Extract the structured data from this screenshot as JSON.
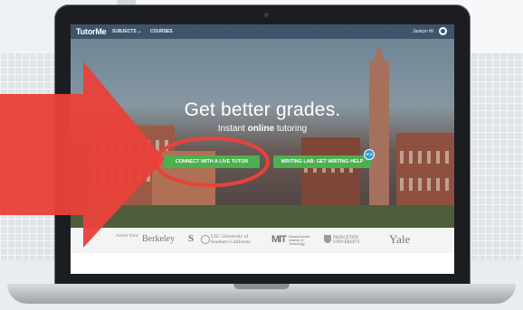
{
  "app": {
    "logo": "TutorMe",
    "nav": {
      "subjects": "SUBJECTS ⌄",
      "courses": "COURSES"
    },
    "user": {
      "name": "Jaskiyn W."
    }
  },
  "hero": {
    "headline": "Get better grades.",
    "subheadline_pre": "Instant ",
    "subheadline_bold": "online",
    "subheadline_post": " tutoring",
    "buttons": {
      "live_tutor": "CONNECT WITH A LIVE TUTOR",
      "writing_lab": "WRITING LAB: GET WRITING HELP",
      "badge": "NEW"
    }
  },
  "logos": {
    "tutors_from": "Tutors from:",
    "berkeley": "Berkeley",
    "stanford": "S",
    "usc": "USC University of Southern California",
    "mit": "MIT",
    "mit_sub": "Massachusetts Institute of Technology",
    "princeton": "PRINCETON UNIVERSITY",
    "yale": "Yale"
  },
  "colors": {
    "button_green": "#4caf50",
    "annotation_red": "#e8423a",
    "navbar": "#1d3550"
  }
}
